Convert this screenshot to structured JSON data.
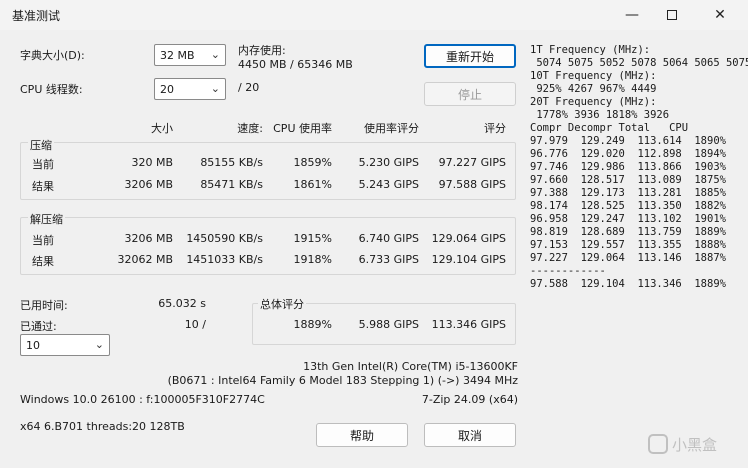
{
  "window": {
    "title": "基准测试"
  },
  "settings": {
    "dict_label": "字典大小(D):",
    "dict_value": "32 MB",
    "threads_label": "CPU 线程数:",
    "threads_value": "20",
    "threads_total": "/ 20",
    "mem_label": "内存使用:",
    "mem_value": "4450 MB / 65346 MB"
  },
  "buttons": {
    "restart": "重新开始",
    "stop": "停止",
    "help": "帮助",
    "cancel": "取消"
  },
  "columns": {
    "size": "大小",
    "speed": "速度:",
    "cpu_usage": "CPU 使用率",
    "usage_rating": "使用率评分",
    "rating": "评分"
  },
  "compress": {
    "label": "压缩",
    "current": {
      "label": "当前",
      "size": "320 MB",
      "speed": "85155 KB/s",
      "usage": "1859%",
      "urating": "5.230 GIPS",
      "rating": "97.227 GIPS"
    },
    "result": {
      "label": "结果",
      "size": "3206 MB",
      "speed": "85471 KB/s",
      "usage": "1861%",
      "urating": "5.243 GIPS",
      "rating": "97.588 GIPS"
    }
  },
  "decompress": {
    "label": "解压缩",
    "current": {
      "label": "当前",
      "size": "3206 MB",
      "speed": "1450590 KB/s",
      "usage": "1915%",
      "urating": "6.740 GIPS",
      "rating": "129.064 GIPS"
    },
    "result": {
      "label": "结果",
      "size": "32062 MB",
      "speed": "1451033 KB/s",
      "usage": "1918%",
      "urating": "6.733 GIPS",
      "rating": "129.104 GIPS"
    }
  },
  "status": {
    "elapsed_label": "已用时间:",
    "elapsed_value": "65.032 s",
    "passes_label": "已通过:",
    "passes_value": "10 /",
    "passes_select": "10"
  },
  "total": {
    "label": "总体评分",
    "usage": "1889%",
    "urating": "5.988 GIPS",
    "rating": "113.346 GIPS"
  },
  "cpu_info": {
    "name": "13th Gen Intel(R) Core(TM) i5-13600KF",
    "detail": "(B0671 : Intel64 Family 6 Model 183 Stepping 1) (->) 3494 MHz",
    "os": "Windows 10.0 26100 : f:100005F310F2774C",
    "version": "7-Zip 24.09 (x64)",
    "build": "x64 6.B701 threads:20 128TB"
  },
  "freq": {
    "lines": [
      "1T Frequency (MHz):",
      " 5074 5075 5052 5078 5064 5065 5075",
      "10T Frequency (MHz):",
      " 925% 4267 967% 4449",
      "20T Frequency (MHz):",
      " 1778% 3936 1818% 3926",
      "Compr Decompr Total   CPU",
      "97.979  129.249  113.614  1890%",
      "96.776  129.020  112.898  1894%",
      "97.746  129.986  113.866  1903%",
      "97.660  128.517  113.089  1875%",
      "97.388  129.173  113.281  1885%",
      "98.174  128.525  113.350  1882%",
      "96.958  129.247  113.102  1901%",
      "98.819  128.689  113.759  1889%",
      "97.153  129.557  113.355  1888%",
      "97.227  129.064  113.146  1887%",
      "------------",
      "97.588  129.104  113.346  1889%"
    ]
  },
  "watermark": {
    "text": "小黑盒"
  }
}
